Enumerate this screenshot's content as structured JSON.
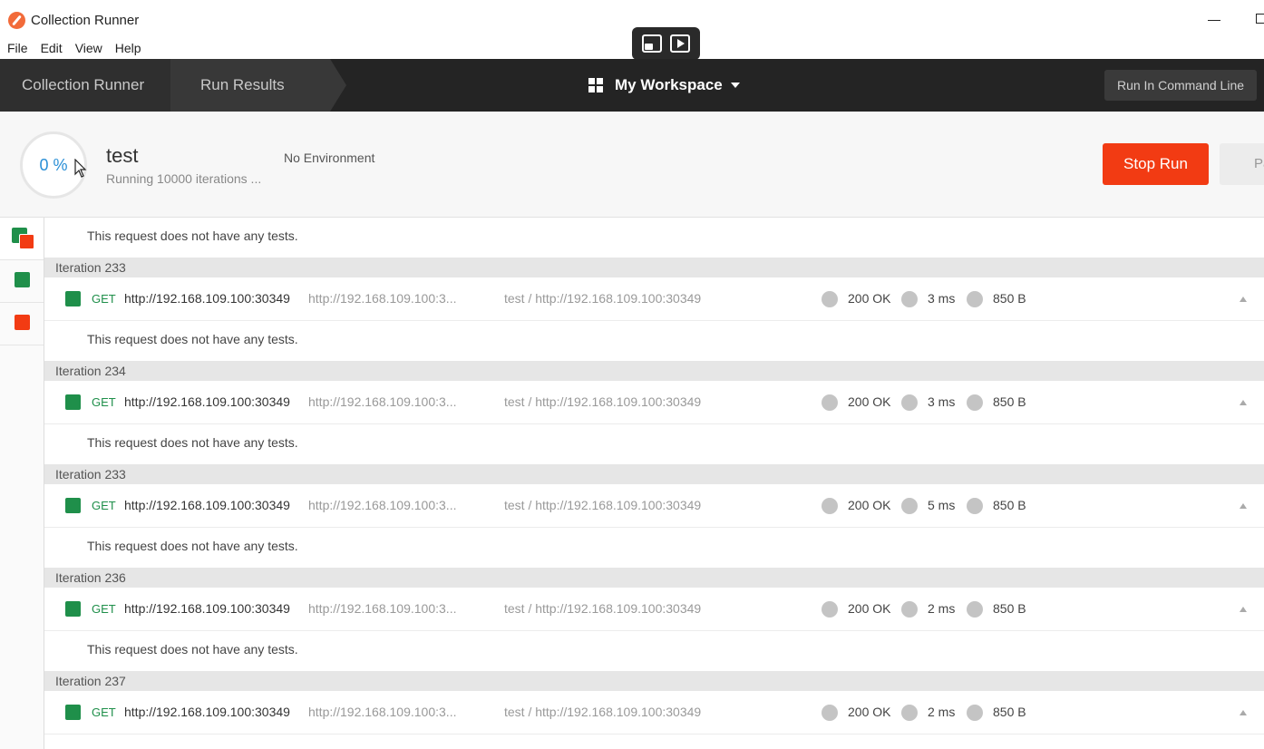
{
  "window": {
    "title": "Collection Runner"
  },
  "menu": [
    "File",
    "Edit",
    "View",
    "Help"
  ],
  "header": {
    "breadcrumbs": [
      "Collection Runner",
      "Run Results"
    ],
    "workspace": "My Workspace",
    "command_line_button": "Run In Command Line"
  },
  "run": {
    "progress_label": "0 %",
    "progress_percent": 0,
    "name": "test",
    "status": "Running 10000 iterations ...",
    "environment": "No Environment",
    "stop_button": "Stop Run",
    "pause_button": "Pa"
  },
  "colors": {
    "pass": "#1f8f4a",
    "fail": "#f23b13",
    "progress": "#2a8fd6"
  },
  "no_tests_text": "This request does not have any tests.",
  "iterations": [
    {
      "label": "Iteration 233",
      "method": "GET",
      "name": "http://192.168.109.100:30349",
      "url": "http://192.168.109.100:3...",
      "path": "test / http://192.168.109.100:30349",
      "status": "200 OK",
      "time": "3 ms",
      "size": "850 B"
    },
    {
      "label": "Iteration 234",
      "method": "GET",
      "name": "http://192.168.109.100:30349",
      "url": "http://192.168.109.100:3...",
      "path": "test / http://192.168.109.100:30349",
      "status": "200 OK",
      "time": "3 ms",
      "size": "850 B"
    },
    {
      "label": "Iteration 233",
      "method": "GET",
      "name": "http://192.168.109.100:30349",
      "url": "http://192.168.109.100:3...",
      "path": "test / http://192.168.109.100:30349",
      "status": "200 OK",
      "time": "5 ms",
      "size": "850 B"
    },
    {
      "label": "Iteration 236",
      "method": "GET",
      "name": "http://192.168.109.100:30349",
      "url": "http://192.168.109.100:3...",
      "path": "test / http://192.168.109.100:30349",
      "status": "200 OK",
      "time": "2 ms",
      "size": "850 B"
    },
    {
      "label": "Iteration 237",
      "method": "GET",
      "name": "http://192.168.109.100:30349",
      "url": "http://192.168.109.100:3...",
      "path": "test / http://192.168.109.100:30349",
      "status": "200 OK",
      "time": "2 ms",
      "size": "850 B"
    }
  ]
}
